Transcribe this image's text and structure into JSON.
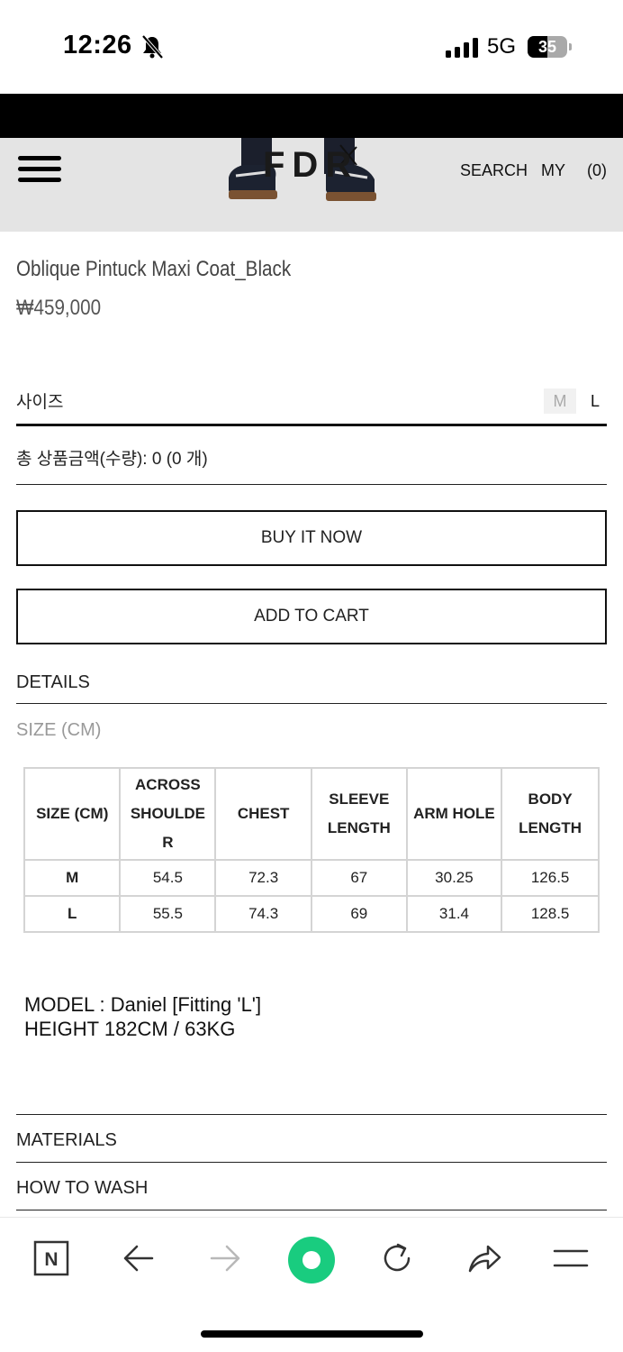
{
  "status_bar": {
    "time": "12:26",
    "network": "5G",
    "battery": "35"
  },
  "header": {
    "logo": "FDR",
    "search": "SEARCH",
    "my": "MY",
    "cart": "(0)"
  },
  "product": {
    "title": "Oblique Pintuck Maxi Coat_Black",
    "price": "₩459,000"
  },
  "options": {
    "size_label": "사이즈",
    "sizes": [
      "M",
      "L"
    ],
    "total_label": "총 상품금액(수량): 0 (0 개)"
  },
  "buttons": {
    "buy_now": "BUY IT NOW",
    "add_to_cart": "ADD TO CART"
  },
  "sections": {
    "details": "DETAILS",
    "size_cm": "SIZE (CM)",
    "materials": "MATERIALS",
    "how_to_wash": "HOW TO WASH"
  },
  "size_table": {
    "headers": [
      "SIZE (CM)",
      "ACROSS SHOULDE R",
      "CHEST",
      "SLEEVE LENGTH",
      "ARM HOLE",
      "BODY LENGTH"
    ],
    "rows": [
      [
        "M",
        "54.5",
        "72.3",
        "67",
        "30.25",
        "126.5"
      ],
      [
        "L",
        "55.5",
        "74.3",
        "69",
        "31.4",
        "128.5"
      ]
    ]
  },
  "model_info": {
    "line1": "MODEL : Daniel [Fitting 'L']",
    "line2": "HEIGHT 182CM / 63KG"
  },
  "toolbar": {
    "icons": [
      "naver-icon",
      "back-icon",
      "forward-icon",
      "green-dot-icon",
      "reload-icon",
      "share-icon",
      "menu-icon"
    ],
    "naver_letter": "N"
  }
}
